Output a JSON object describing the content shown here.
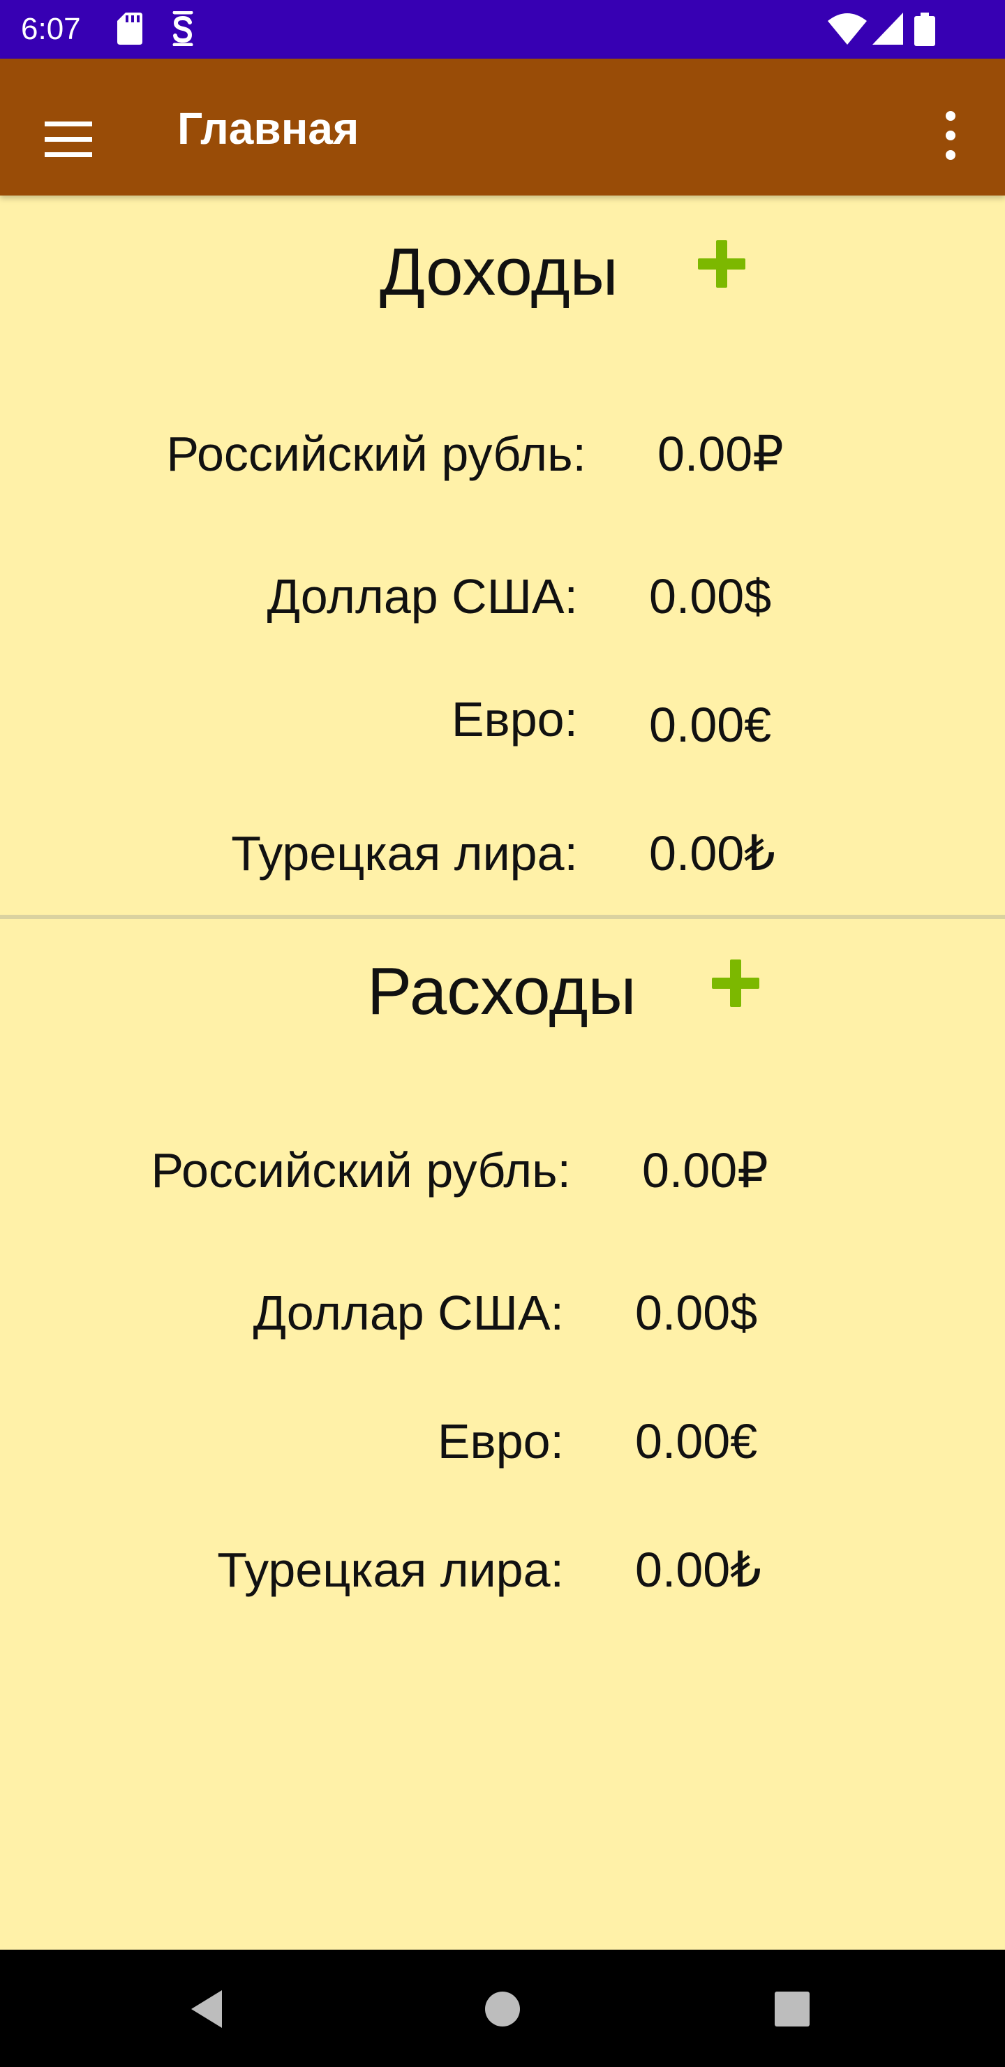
{
  "status_bar": {
    "time": "6:07",
    "icons": [
      "sd-card-icon",
      "s-icon",
      "wifi-icon",
      "signal-icon",
      "battery-icon"
    ]
  },
  "toolbar": {
    "title": "Главная",
    "menu_icon": "hamburger-menu-icon",
    "overflow_icon": "overflow-menu-icon"
  },
  "income": {
    "title": "Доходы",
    "add_icon": "plus-icon",
    "rows": [
      {
        "label": "Российский рубль:",
        "value": "0.00₽"
      },
      {
        "label": "Доллар США:",
        "value": "0.00$"
      },
      {
        "label": "Евро:",
        "value": "0.00€"
      },
      {
        "label": "Турецкая лира:",
        "value": "0.00₺"
      }
    ]
  },
  "expenses": {
    "title": "Расходы",
    "add_icon": "plus-icon",
    "rows": [
      {
        "label": "Российский рубль:",
        "value": "0.00₽"
      },
      {
        "label": "Доллар США:",
        "value": "0.00$"
      },
      {
        "label": "Евро:",
        "value": "0.00€"
      },
      {
        "label": "Турецкая лира:",
        "value": "0.00₺"
      }
    ]
  },
  "navigation": {
    "icons": [
      "back-icon",
      "home-icon",
      "recents-icon"
    ]
  },
  "colors": {
    "status_bar": "#3700B3",
    "toolbar": "#994C07",
    "background": "#FFF1A8",
    "add_button": "#7CB800"
  }
}
